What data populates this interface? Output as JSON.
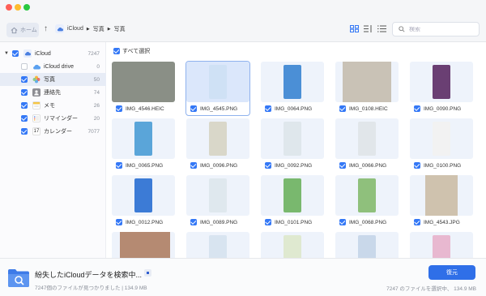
{
  "toolbar": {
    "home_label": "ホーム",
    "breadcrumb": [
      "iCloud",
      "写真",
      "写真"
    ],
    "search_placeholder": "検索"
  },
  "sidebar": {
    "root": {
      "label": "iCloud",
      "count": "7247"
    },
    "items": [
      {
        "label": "iCloud drive",
        "count": "0",
        "checked": false,
        "icon": "cloud-icon"
      },
      {
        "label": "写真",
        "count": "50",
        "checked": true,
        "icon": "photos-icon",
        "active": true
      },
      {
        "label": "連絡先",
        "count": "74",
        "checked": true,
        "icon": "contacts-icon"
      },
      {
        "label": "メモ",
        "count": "26",
        "checked": true,
        "icon": "notes-icon"
      },
      {
        "label": "リマインダー",
        "count": "20",
        "checked": true,
        "icon": "reminders-icon"
      },
      {
        "label": "カレンダー",
        "count": "7077",
        "checked": true,
        "icon": "calendar-icon"
      }
    ]
  },
  "main": {
    "select_all_label": "すべて選択",
    "files": [
      "IMG_4546.HEIC",
      "IMG_4545.PNG",
      "IMG_0064.PNG",
      "IMG_0108.HEIC",
      "IMG_0090.PNG",
      "IMG_0065.PNG",
      "IMG_0096.PNG",
      "IMG_0092.PNG",
      "IMG_0066.PNG",
      "IMG_0100.PNG",
      "IMG_0012.PNG",
      "IMG_0089.PNG",
      "IMG_0101.PNG",
      "IMG_0068.PNG",
      "IMG_4543.JPG"
    ],
    "selected_file": "IMG_4545.PNG"
  },
  "footer": {
    "scan_title": "紛失したiCloudデータを検索中...",
    "scan_subtitle": "7247個のファイルが見つかりました | 134.9 MB",
    "restore_label": "復元",
    "selection_info": "7247 のファイルを選択中、 134.9 MB"
  },
  "colors": {
    "accent": "#2f6fe8",
    "checkbox": "#3478f6",
    "sidebar_active": "#e7ecf6",
    "thumb_bg": "#eef3fb"
  }
}
